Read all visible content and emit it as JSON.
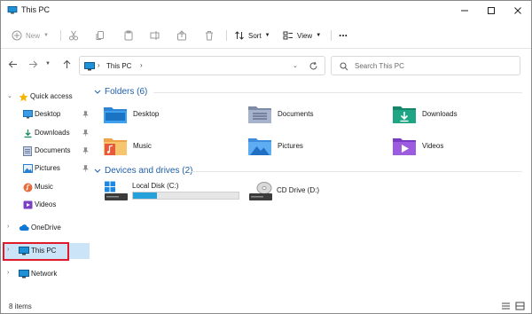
{
  "window": {
    "title": "This PC"
  },
  "toolbar": {
    "new_label": "New",
    "sort_label": "Sort",
    "view_label": "View",
    "more_label": "..."
  },
  "address": {
    "crumbs": [
      "This PC"
    ]
  },
  "search": {
    "placeholder": "Search This PC"
  },
  "sidebar": {
    "items": [
      {
        "label": "Quick access",
        "icon": "star-icon"
      },
      {
        "label": "Desktop",
        "icon": "desktop-icon"
      },
      {
        "label": "Downloads",
        "icon": "downloads-icon"
      },
      {
        "label": "Documents",
        "icon": "documents-icon"
      },
      {
        "label": "Pictures",
        "icon": "pictures-icon"
      },
      {
        "label": "Music",
        "icon": "music-icon"
      },
      {
        "label": "Videos",
        "icon": "videos-icon"
      },
      {
        "label": "OneDrive",
        "icon": "cloud-icon"
      },
      {
        "label": "This PC",
        "icon": "pc-icon"
      },
      {
        "label": "Network",
        "icon": "network-icon"
      }
    ]
  },
  "folders": {
    "heading": "Folders (6)",
    "items": [
      {
        "label": "Desktop",
        "icon": "desktop-folder-icon"
      },
      {
        "label": "Documents",
        "icon": "documents-folder-icon"
      },
      {
        "label": "Downloads",
        "icon": "downloads-folder-icon"
      },
      {
        "label": "Music",
        "icon": "music-folder-icon"
      },
      {
        "label": "Pictures",
        "icon": "pictures-folder-icon"
      },
      {
        "label": "Videos",
        "icon": "videos-folder-icon"
      }
    ]
  },
  "drives": {
    "heading": "Devices and drives (2)",
    "items": [
      {
        "label": "Local Disk (C:)",
        "icon": "hard-drive-icon",
        "used_fraction": 0.23
      },
      {
        "label": "CD Drive (D:)",
        "icon": "cd-drive-icon"
      }
    ]
  },
  "statusbar": {
    "count": "8 items"
  },
  "colors": {
    "accent": "#1f5fa8",
    "selection": "#cce4f7",
    "highlight": "#e0192b",
    "usage_bar": "#26a0da"
  }
}
